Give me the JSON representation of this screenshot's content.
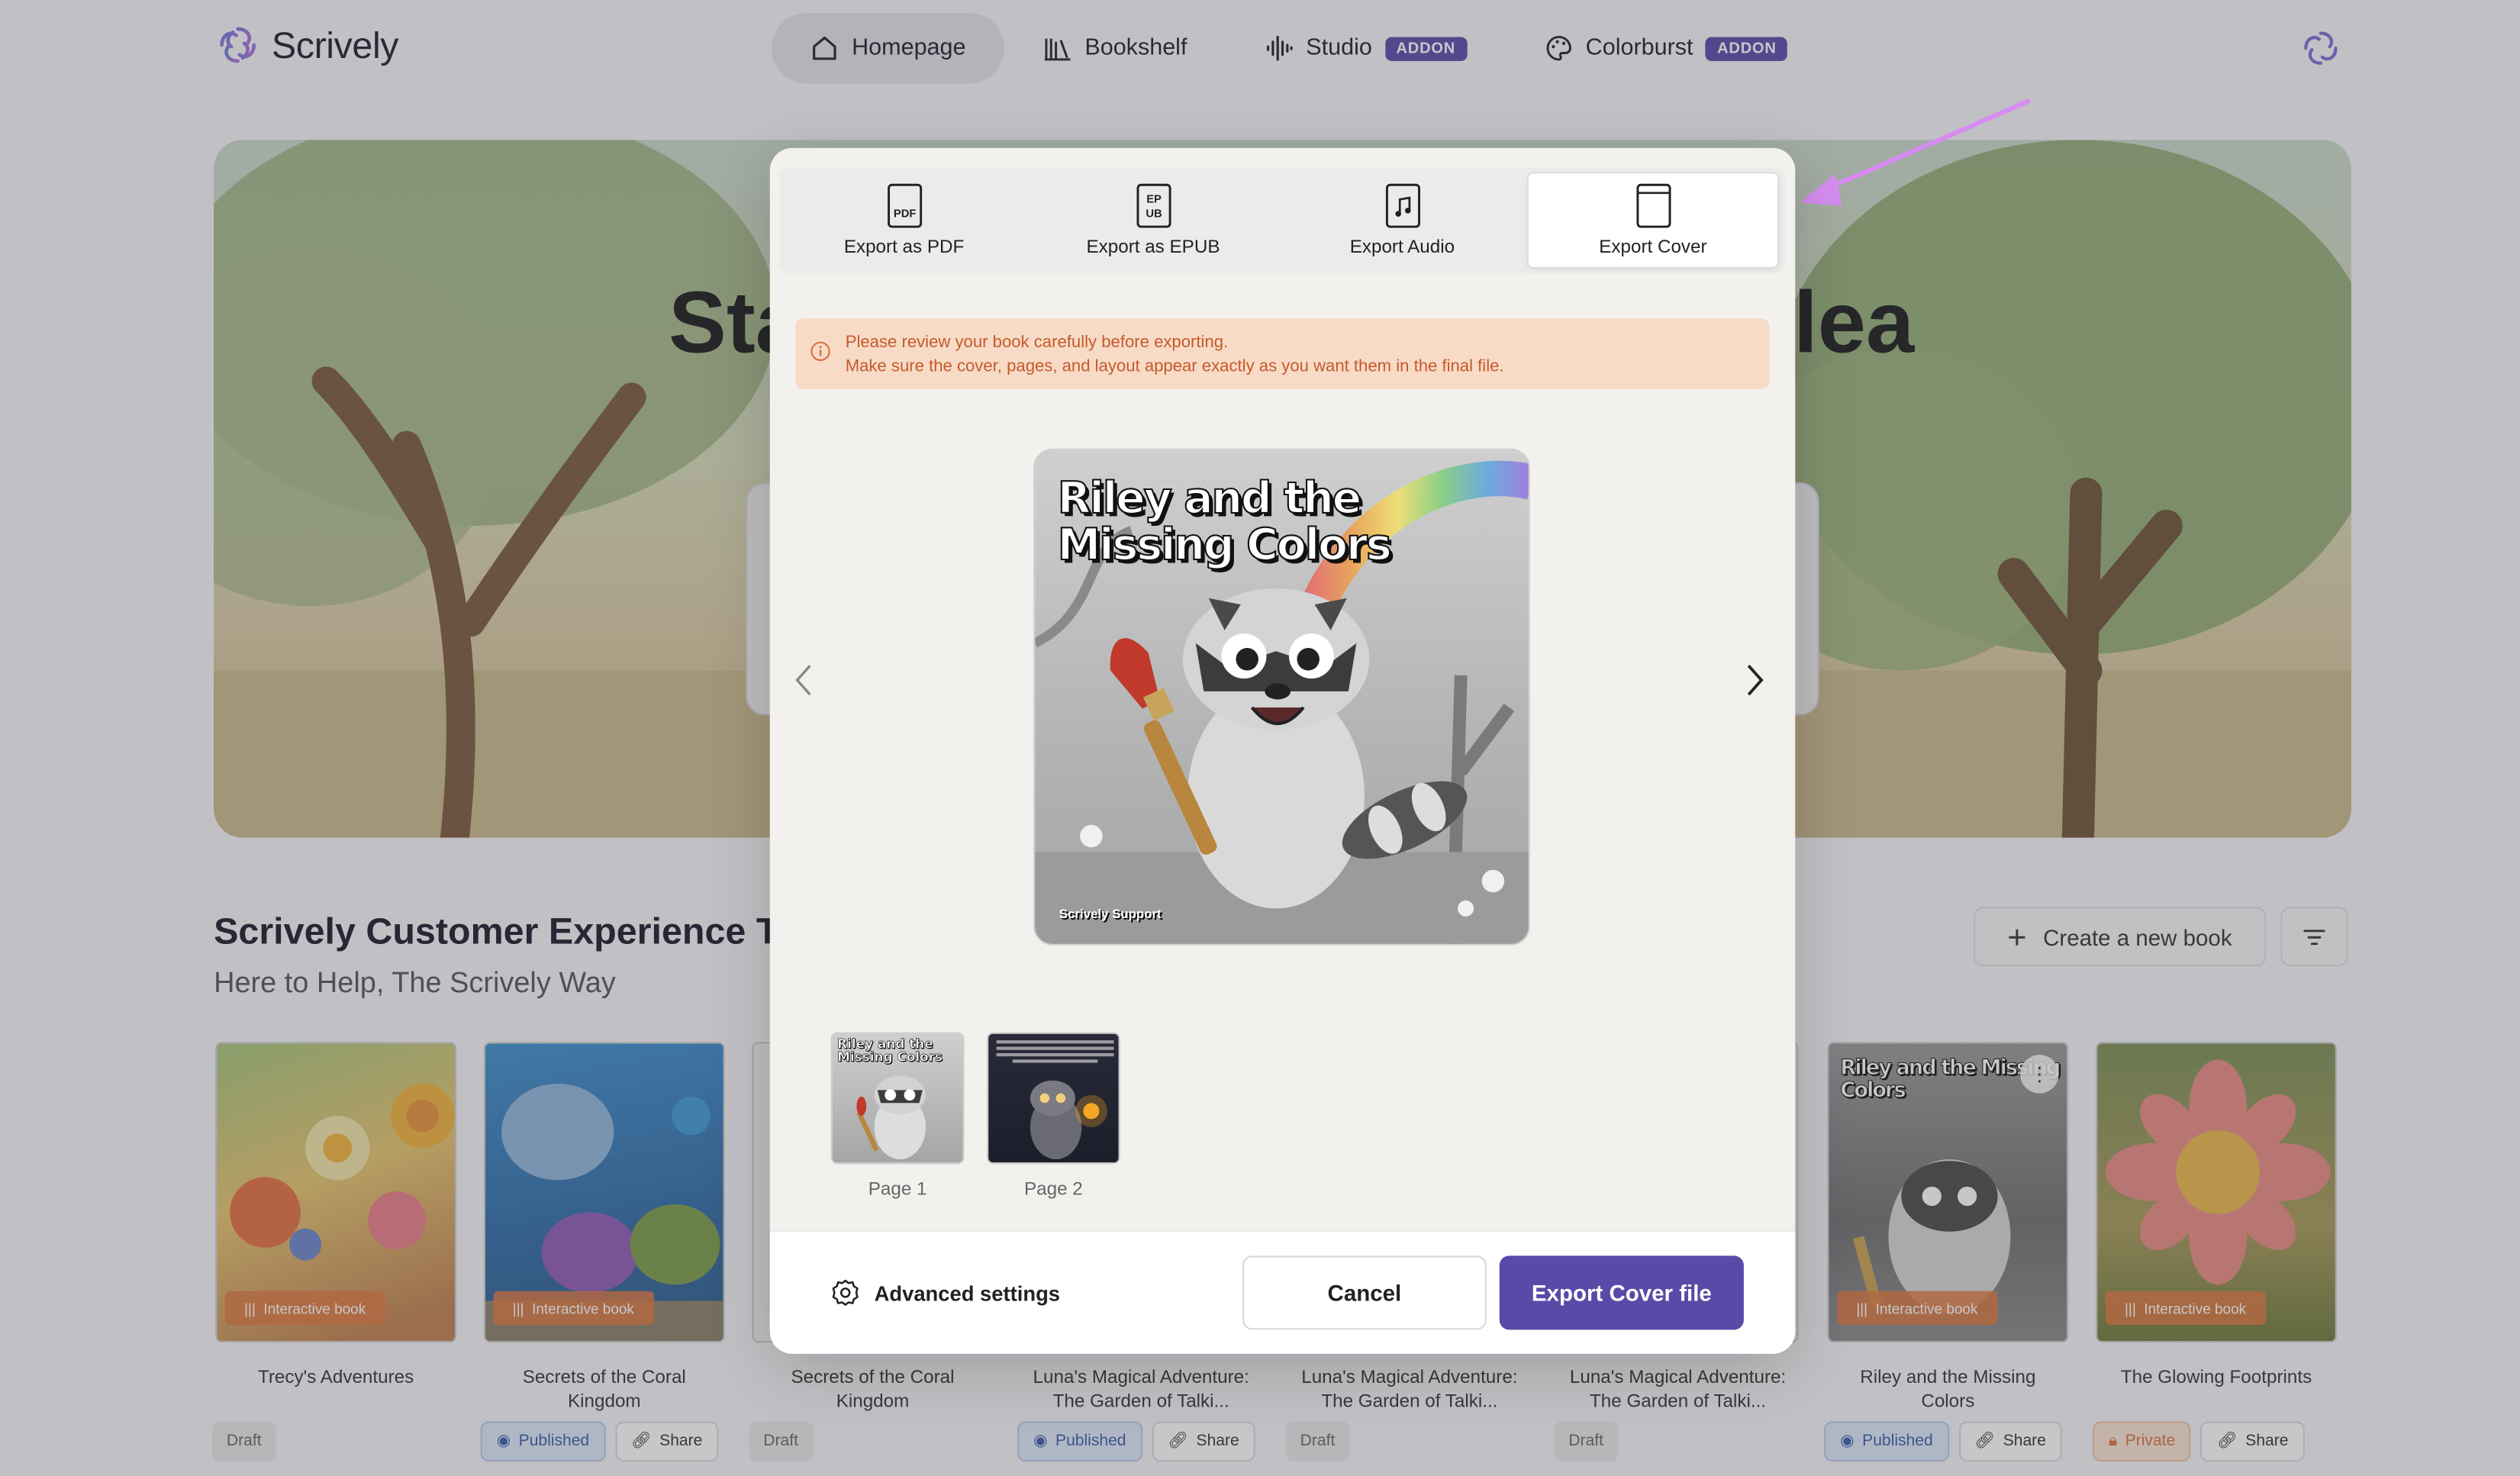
{
  "app": {
    "name": "Scrively"
  },
  "nav": {
    "homepage": "Homepage",
    "bookshelf": "Bookshelf",
    "studio": "Studio",
    "colorburst": "Colorburst",
    "addon": "ADDON"
  },
  "hero": {
    "title_left": "Sta",
    "title_right": "lea"
  },
  "workspace": {
    "title": "Scrively Customer Experience Te",
    "subtitle": "Here to Help, The Scrively Way",
    "create_label": "Create a new book"
  },
  "books": [
    {
      "title": "Trecy's Adventures",
      "tag": "Interactive book",
      "status": "Draft",
      "share": ""
    },
    {
      "title": "Secrets of the Coral Kingdom",
      "tag": "Interactive book",
      "status": "Published",
      "share": "Share"
    },
    {
      "title": "Secrets of the Coral Kingdom",
      "tag": "",
      "status": "Draft",
      "share": ""
    },
    {
      "title": "Luna's Magical Adventure: The Garden of Talki...",
      "tag": "",
      "status": "Published",
      "share": "Share"
    },
    {
      "title": "Luna's Magical Adventure: The Garden of Talki...",
      "tag": "",
      "status": "Draft",
      "share": ""
    },
    {
      "title": "Luna's Magical Adventure: The Garden of Talki...",
      "tag": "",
      "status": "Draft",
      "share": ""
    },
    {
      "title": "Riley and the Missing Colors",
      "tag": "Interactive book",
      "status": "Published",
      "share": "Share"
    },
    {
      "title": "The Glowing Footprints",
      "tag": "Interactive book",
      "status": "Private",
      "share": "Share"
    }
  ],
  "modal": {
    "tabs": {
      "pdf": "Export as PDF",
      "epub": "Export as EPUB",
      "audio": "Export Audio",
      "cover": "Export Cover"
    },
    "alert_line1": "Please review your book carefully before exporting.",
    "alert_line2": "Make sure the cover, pages, and layout appear exactly as you want them in the final file.",
    "cover_title": "Riley and the Missing Colors",
    "cover_author": "Scrively Support",
    "pages": [
      "Page 1",
      "Page 2"
    ],
    "advanced": "Advanced settings",
    "cancel": "Cancel",
    "export": "Export Cover file"
  },
  "colors": {
    "accent": "#5b49a8",
    "alert_bg": "#f7dbc7",
    "alert_text": "#c65a2a"
  }
}
